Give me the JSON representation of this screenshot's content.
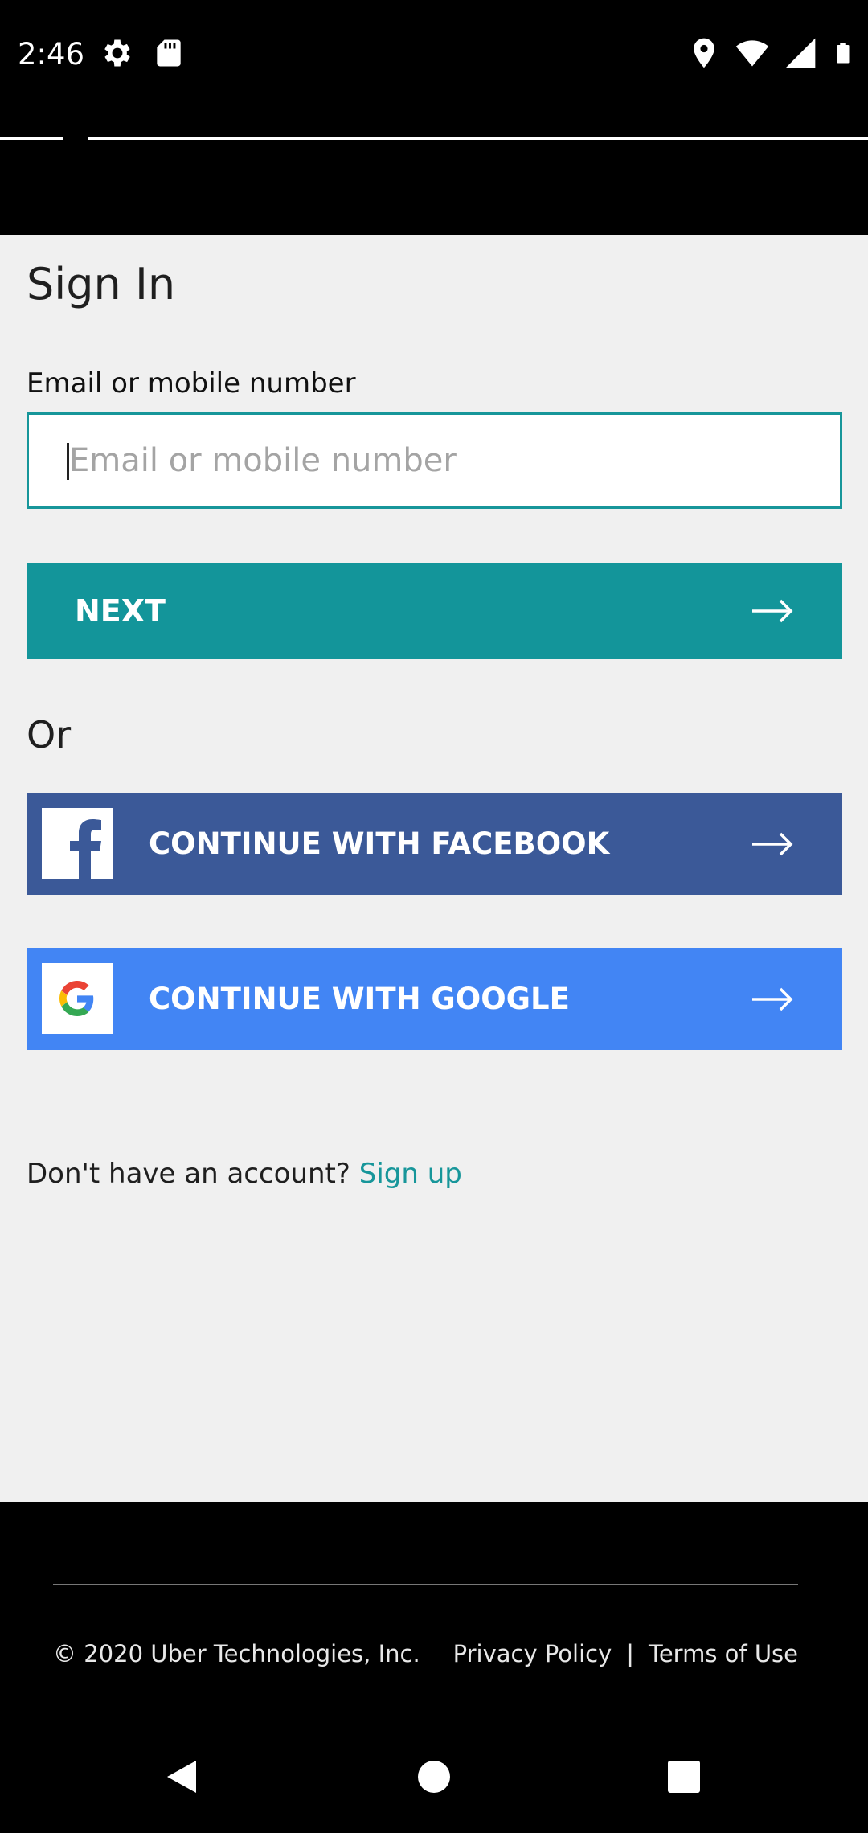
{
  "status_bar": {
    "time": "2:46",
    "left_icons": [
      "gear-icon",
      "sd-card-icon"
    ],
    "right_icons": [
      "location-icon",
      "wifi-icon",
      "cell-signal-icon",
      "battery-icon"
    ]
  },
  "sign_in": {
    "title": "Sign In",
    "email_label": "Email or mobile number",
    "email_placeholder": "Email or mobile number",
    "email_value": "",
    "next_label": "NEXT",
    "or_label": "Or",
    "facebook_label": "CONTINUE WITH FACEBOOK",
    "google_label": "CONTINUE WITH GOOGLE",
    "no_account_text": "Don't have an account?",
    "signup_link": "Sign up"
  },
  "footer": {
    "copyright": "© 2020 Uber Technologies, Inc.",
    "privacy": "Privacy Policy",
    "separator": "|",
    "terms": "Terms of Use"
  },
  "colors": {
    "accent_teal": "#13959a",
    "facebook_blue": "#3b5998",
    "google_blue": "#4285f4",
    "page_bg": "#f0f0f0"
  },
  "navigation": {
    "buttons": [
      "back-icon",
      "home-icon",
      "recents-icon"
    ]
  }
}
